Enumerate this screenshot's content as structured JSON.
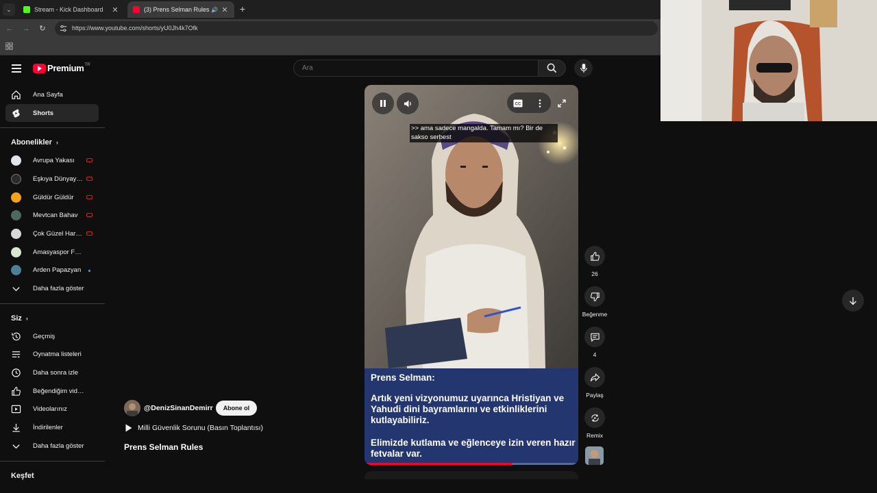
{
  "browser": {
    "tabs": [
      {
        "title": "Stream - Kick Dashboard",
        "favicon_color": "#53fc18",
        "active": false
      },
      {
        "title": "(3) Prens Selman Rules - YouTube",
        "favicon_color": "#ff0033",
        "active": true
      }
    ],
    "url": "https://www.youtube.com/shorts/yU0Jh4k7Ofk"
  },
  "header": {
    "logo_text": "Premium",
    "logo_region": "TR",
    "search_placeholder": "Ara"
  },
  "sidebar": {
    "main": [
      {
        "label": "Ana Sayfa",
        "icon": "home-icon"
      },
      {
        "label": "Shorts",
        "icon": "shorts-icon",
        "active": true
      }
    ],
    "subscriptions_title": "Abonelikler",
    "subscriptions": [
      {
        "label": "Avrupa Yakası",
        "status": "live",
        "avatar_color": "#dfe6ee"
      },
      {
        "label": "Eşkıya Dünyaya Hükümdar Olmaz",
        "status": "live",
        "avatar_color": "#2b2b2b"
      },
      {
        "label": "Güldür Güldür",
        "status": "live",
        "avatar_color": "#f2a31b"
      },
      {
        "label": "Mevtcan Bahav",
        "status": "live",
        "avatar_color": "#4a6a5e"
      },
      {
        "label": "Çok Güzel Hareketler",
        "status": "live",
        "avatar_color": "#d9d9d9"
      },
      {
        "label": "Amasyaspor Futbol",
        "status": "none",
        "avatar_color": "#d9e6d4"
      },
      {
        "label": "Arden Papazyan",
        "status": "new",
        "avatar_color": "#4b7f9a"
      }
    ],
    "subscriptions_more": "Daha fazla göster",
    "you_title": "Siz",
    "you": [
      {
        "label": "Geçmiş",
        "icon": "history-icon"
      },
      {
        "label": "Oynatma listeleri",
        "icon": "playlists-icon"
      },
      {
        "label": "Daha sonra izle",
        "icon": "watch-later-icon"
      },
      {
        "label": "Beğendiğim videolar",
        "icon": "liked-icon"
      },
      {
        "label": "Videolarınız",
        "icon": "your-videos-icon"
      },
      {
        "label": "İndirilenler",
        "icon": "downloads-icon"
      }
    ],
    "you_more": "Daha fazla göster",
    "explore_title": "Keşfet"
  },
  "player": {
    "subtitle": ">> ama sadece mangalda. Tamam mı? Bir de sakso serbest",
    "caption_name": "Prens Selman:",
    "caption_p1": "Artık yeni vizyonumuz uyarınca Hristiyan ve Yahudi dini bayramlarını ve etkinliklerini kutlayabiliriz.",
    "caption_p2": "Elimizde kutlama ve eğlenceye izin veren hazır fetvalar var.",
    "progress": 0.69
  },
  "actions": {
    "like_count": "26",
    "dislike_label": "Beğenme",
    "comment_count": "4",
    "share_label": "Paylaş",
    "remix_label": "Remix"
  },
  "meta": {
    "channel": "@DenizSinanDemirr",
    "subscribe_label": "Abone ol",
    "audio_title": "Milli Güvenlik Sorunu (Basın Toplantısı)",
    "title": "Prens Selman Rules"
  }
}
